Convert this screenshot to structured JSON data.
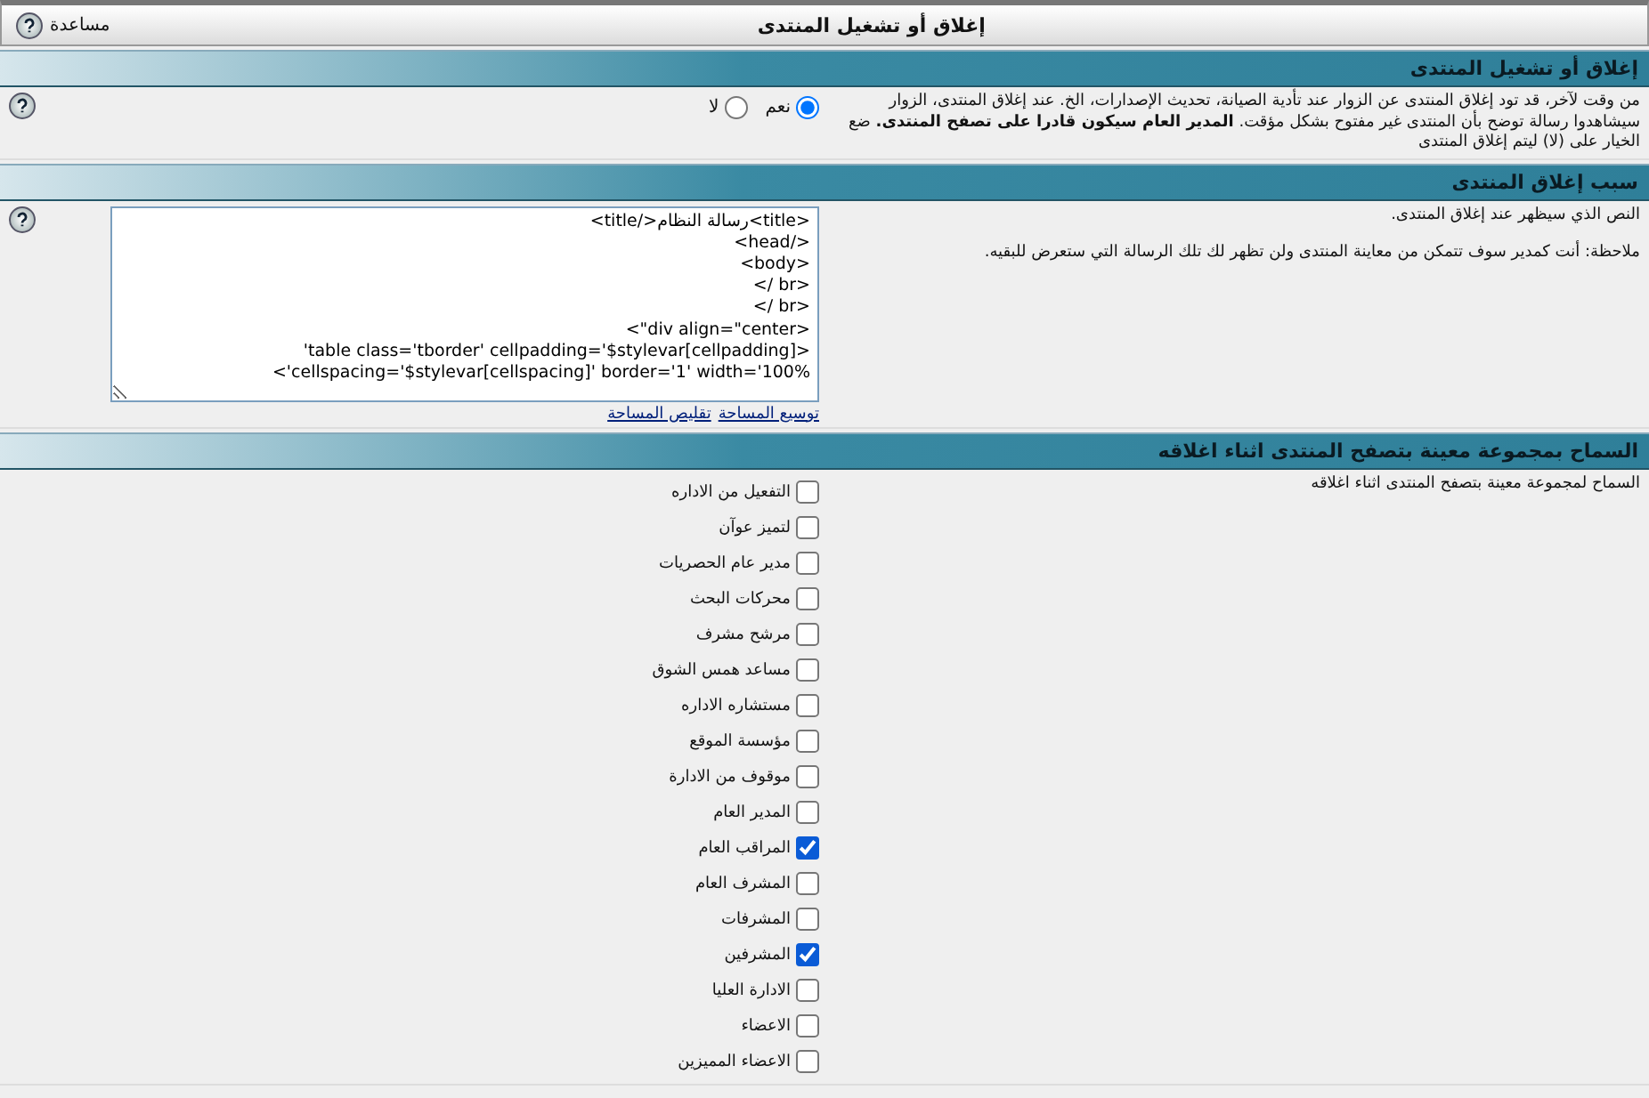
{
  "window": {
    "title": "إغلاق أو تشغيل المنتدى",
    "help": "مساعدة"
  },
  "sections": [
    {
      "kind": "radio",
      "title": "إغلاق أو تشغيل المنتدى",
      "description": "من وقت لآخر، قد تود إغلاق المنتدى عن الزوار عند تأدية الصيانة، تحديث الإصدارات، الخ. عند إغلاق المنتدى، الزوار سيشاهدوا رسالة توضح بأن المنتدى غير مفتوح بشكل مؤقت. **المدير العام سيكون قادرا على تصفح المنتدى.** ضع الخيار على (لا) ليتم إغلاق المنتدى",
      "options": [
        {
          "label": "نعم",
          "selected": true
        },
        {
          "label": "لا",
          "selected": false
        }
      ]
    },
    {
      "kind": "textarea",
      "title": "سبب إغلاق المنتدى",
      "description": "النص الذي سيظهر عند إغلاق المنتدى.",
      "note": "ملاحظة: أنت كمدير سوف تتمكن من معاينة المنتدى ولن تظهر لك تلك الرسالة التي ستعرض للبقيه.",
      "lines": [
        "<title>رسالة النظام</title>",
        "</head>",
        "<body>",
        "<br />",
        "<br />",
        "<div align=\"center\">",
        "<table class='tborder' cellpadding='$stylevar[cellpadding]'",
        "cellspacing='$stylevar[cellspacing]' border='1' width='100%'>"
      ],
      "links": [
        "توسيع المساحة",
        "تقليص المساحة"
      ]
    },
    {
      "kind": "checklist",
      "title": "السماح بمجموعة معينة بتصفح المنتدى اثناء اغلاقه",
      "description": "السماح لمجموعة معينة بتصفح المنتدى اثناء اغلاقه",
      "items": [
        {
          "label": "التفعيل من الاداره",
          "checked": false
        },
        {
          "label": "لتميز عوآن",
          "checked": false
        },
        {
          "label": "مدير عام الحصريات",
          "checked": false
        },
        {
          "label": "محركات البحث",
          "checked": false
        },
        {
          "label": "مرشح مشرف",
          "checked": false
        },
        {
          "label": "مساعد همس الشوق",
          "checked": false
        },
        {
          "label": "مستشاره الاداره",
          "checked": false
        },
        {
          "label": "مؤسسة الموقع",
          "checked": false
        },
        {
          "label": "موقوف من الادارة",
          "checked": false
        },
        {
          "label": "المدير العام",
          "checked": false
        },
        {
          "label": "المراقب العام",
          "checked": true
        },
        {
          "label": "المشرف العام",
          "checked": false
        },
        {
          "label": "المشرفات",
          "checked": false
        },
        {
          "label": "المشرفين",
          "checked": true
        },
        {
          "label": "الادارة العليا",
          "checked": false
        },
        {
          "label": "الاعضاء",
          "checked": false
        },
        {
          "label": "الاعضاء المميزين",
          "checked": false
        }
      ]
    }
  ]
}
